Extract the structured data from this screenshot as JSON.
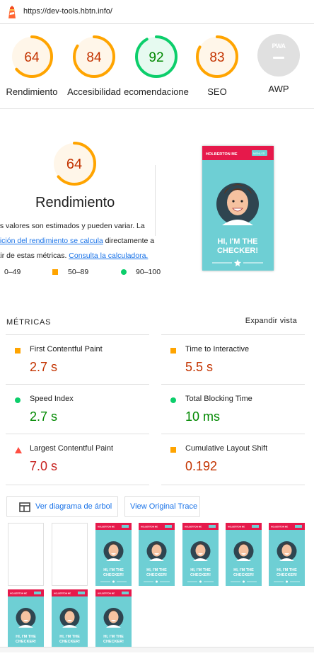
{
  "header": {
    "url": "https://dev-tools.hbtn.info/"
  },
  "gauges": [
    {
      "score": "64",
      "label": "Rendimiento",
      "value": 0.64,
      "color": "#ffa400",
      "text_color": "#c33300",
      "bg": "#fff6e9"
    },
    {
      "score": "84",
      "label": "Accesibilidad",
      "value": 0.84,
      "color": "#ffa400",
      "text_color": "#c33300",
      "bg": "#fff6e9"
    },
    {
      "score": "92",
      "label": "ecomendacione",
      "value": 0.92,
      "color": "#0cce6b",
      "text_color": "#008800",
      "bg": "#e6faf0"
    },
    {
      "score": "83",
      "label": "SEO",
      "value": 0.83,
      "color": "#ffa400",
      "text_color": "#c33300",
      "bg": "#fff6e9"
    }
  ],
  "pwa": {
    "badge": "PWA",
    "label": "AWP"
  },
  "performance": {
    "score": "64",
    "value": 0.64,
    "title": "Rendimiento",
    "desc_1": "os valores son estimados y pueden variar. La",
    "desc_link_1": "dición del rendimiento se calcula",
    "desc_2": " directamente a",
    "desc_3": "rtir de estas métricas. ",
    "desc_link_2": "Consulta la calculadora.",
    "legend": {
      "bad": "0–49",
      "avg": "50–89",
      "good": "90–100"
    }
  },
  "screenshot": {
    "nav_title": "HOLBERTON ME",
    "nav_btn": "MENU ☰",
    "hero_1": "HI, I'M THE",
    "hero_2": "CHECKER!"
  },
  "metrics": {
    "heading": "MÉTRICAS",
    "expand": "Expandir vista",
    "items": [
      {
        "name": "First Contentful Paint",
        "value": "2.7 s",
        "status": "average"
      },
      {
        "name": "Time to Interactive",
        "value": "5.5 s",
        "status": "average"
      },
      {
        "name": "Speed Index",
        "value": "2.7 s",
        "status": "pass"
      },
      {
        "name": "Total Blocking Time",
        "value": "10 ms",
        "status": "pass"
      },
      {
        "name": "Largest Contentful Paint",
        "value": "7.0 s",
        "status": "fail"
      },
      {
        "name": "Cumulative Layout Shift",
        "value": "0.192",
        "status": "average"
      }
    ]
  },
  "buttons": {
    "treemap": "Ver diagrama de árbol",
    "trace": "View Original Trace"
  },
  "filmstrip": {
    "frames": [
      "blank",
      "blank",
      "page",
      "page",
      "page",
      "page",
      "page",
      "page",
      "page",
      "page"
    ],
    "mini_title": "HOLBERTON ME",
    "mini_hero_1": "HI, I'M THE",
    "mini_hero_2": "CHECKER!"
  },
  "colors": {
    "orange": "#ffa400",
    "green": "#0cce6b",
    "red": "#ff4e42",
    "orange_text": "#c33300",
    "green_text": "#008800",
    "red_text": "#c7221f",
    "link": "#1a73e8",
    "screen_bg": "#6ecfd4",
    "screen_nav": "#e6194b"
  }
}
